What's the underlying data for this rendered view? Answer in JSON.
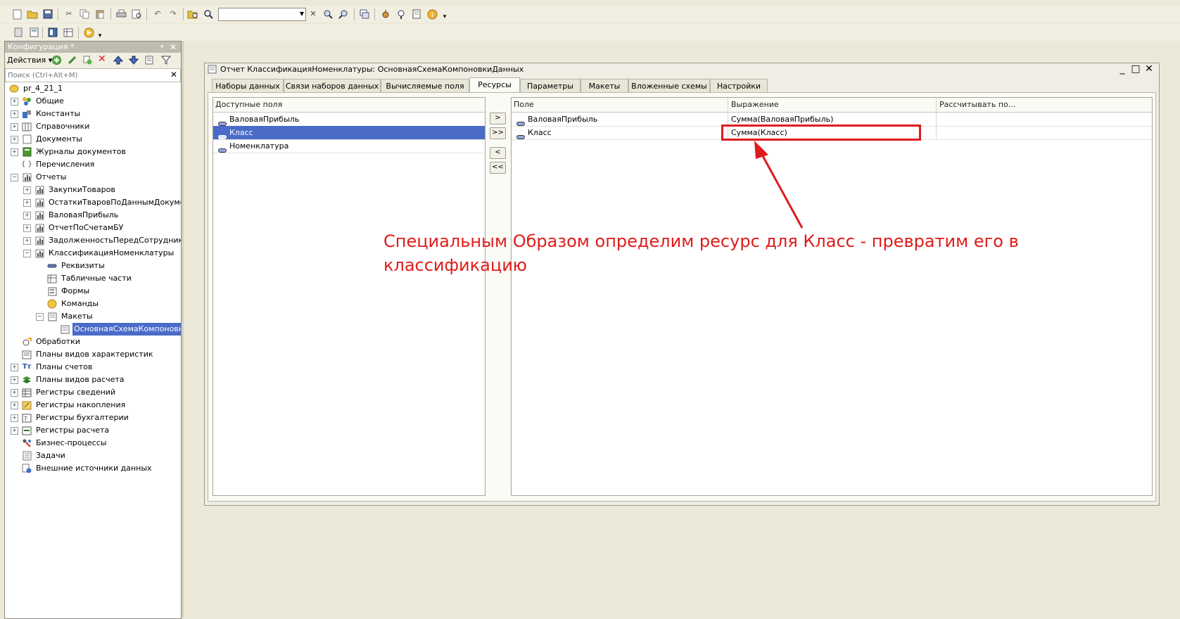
{
  "colors": {
    "accent": "#4a6bc8",
    "annotation": "#e01b1b",
    "background": "#ece9d8"
  },
  "toolbar_row1": {
    "search": {
      "value": "",
      "placeholder": ""
    }
  },
  "left_panel": {
    "title": "Конфигурация *",
    "pin_glyph": "⌖",
    "actions_label": "Действия ▾",
    "search_placeholder": "Поиск (Ctrl+Alt+M)",
    "tree": [
      {
        "label": "pr_4_21_1",
        "icon": "config-root-icon"
      },
      {
        "label": "Общие",
        "icon": "common-icon"
      },
      {
        "label": "Константы",
        "icon": "constants-icon"
      },
      {
        "label": "Справочники",
        "icon": "catalogs-icon"
      },
      {
        "label": "Документы",
        "icon": "documents-icon"
      },
      {
        "label": "Журналы документов",
        "icon": "journals-icon"
      },
      {
        "label": "Перечисления",
        "icon": "enums-icon"
      },
      {
        "label": "Отчеты",
        "icon": "reports-icon"
      },
      {
        "label": "ЗакупкиТоваров",
        "icon": "report-icon"
      },
      {
        "label": "ОстаткиТваровПоДаннымДокументов",
        "icon": "report-icon"
      },
      {
        "label": "ВаловаяПрибыль",
        "icon": "report-icon"
      },
      {
        "label": "ОтчетПоСчетамБУ",
        "icon": "report-icon"
      },
      {
        "label": "ЗадолженностьПередСотрудниками",
        "icon": "report-icon"
      },
      {
        "label": "КлассификацияНоменклатуры",
        "icon": "report-icon"
      },
      {
        "label": "Реквизиты",
        "icon": "attributes-icon"
      },
      {
        "label": "Табличные части",
        "icon": "tabular-sections-icon"
      },
      {
        "label": "Формы",
        "icon": "forms-icon"
      },
      {
        "label": "Команды",
        "icon": "commands-icon"
      },
      {
        "label": "Макеты",
        "icon": "templates-icon"
      },
      {
        "label": "ОсновнаяСхемаКомпоновкиДанных",
        "icon": "template-icon"
      },
      {
        "label": "Обработки",
        "icon": "data-processors-icon"
      },
      {
        "label": "Планы видов характеристик",
        "icon": "chart-of-characteristics-icon"
      },
      {
        "label": "Планы счетов",
        "icon": "chart-of-accounts-icon"
      },
      {
        "label": "Планы видов расчета",
        "icon": "chart-of-calculation-icon"
      },
      {
        "label": "Регистры сведений",
        "icon": "information-registers-icon"
      },
      {
        "label": "Регистры накопления",
        "icon": "accumulation-registers-icon"
      },
      {
        "label": "Регистры бухгалтерии",
        "icon": "accounting-registers-icon"
      },
      {
        "label": "Регистры расчета",
        "icon": "calculation-registers-icon"
      },
      {
        "label": "Бизнес-процессы",
        "icon": "business-processes-icon"
      },
      {
        "label": "Задачи",
        "icon": "tasks-icon"
      },
      {
        "label": "Внешние источники данных",
        "icon": "external-sources-icon"
      }
    ]
  },
  "window": {
    "title": "Отчет КлассификацияНоменклатуры: ОсновнаяСхемаКомпоновкиДанных",
    "controls": {
      "minimize": "_",
      "maximize": "□",
      "close": "✕"
    },
    "tabs": [
      "Наборы данных",
      "Связи наборов данных",
      "Вычисляемые поля",
      "Ресурсы",
      "Параметры",
      "Макеты",
      "Вложенные схемы",
      "Настройки"
    ],
    "active_tab": "Ресурсы",
    "available_fields": {
      "header": "Доступные поля",
      "items": [
        "ВаловаяПрибыль",
        "Класс",
        "Номенклатура"
      ],
      "selected": "Класс"
    },
    "move_buttons": {
      "add": ">",
      "add_all": ">>",
      "remove": "<",
      "remove_all": "<<"
    },
    "resources": {
      "headers": [
        "Поле",
        "Выражение",
        "Рассчитывать по..."
      ],
      "rows": [
        {
          "field": "ВаловаяПрибыль",
          "expression": "Сумма(ВаловаяПрибыль)",
          "calc_by": ""
        },
        {
          "field": "Класс",
          "expression": "Сумма(Класс)",
          "calc_by": ""
        }
      ]
    }
  },
  "annotation": {
    "line1": "Специальным Образом определим ресурс для Класс - превратим его в",
    "line2": "классификацию"
  }
}
